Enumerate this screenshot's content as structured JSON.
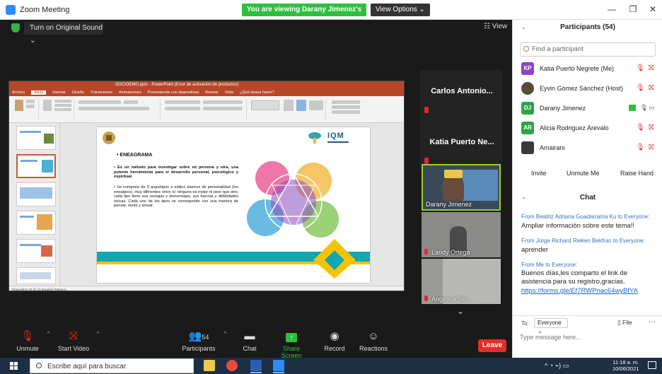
{
  "window": {
    "title": "Zoom Meeting",
    "viewing_banner": "You are viewing Darany Jimenez's screen",
    "view_options": "View Options ⌄",
    "minimize": "—",
    "maximize": "❐",
    "close": "✕"
  },
  "top_controls": {
    "original_sound": "Turn on Original Sound  ⌄",
    "view": "☷ View"
  },
  "shared_screen": {
    "ppt_title": "SOCIOEMO.pptx - PowerPoint (Error de activación de productos)",
    "ppt_tabs": [
      "Archivo",
      "Inicio",
      "Insertar",
      "Diseño",
      "Transiciones",
      "Animaciones",
      "Presentación con diapositivas",
      "Revisar",
      "Vista",
      "¿Qué desea hacer?"
    ],
    "ppt_status": "Diapositiva 10 de 21    Español (México)",
    "slide": {
      "heading": "• ENEAGRAMA",
      "paragraph1": "• Es un método para investigar sobre mi persona y otra, una potente herramienta para el desarrollo personal, psicológico y espiritual.",
      "paragraph2": "• Se compone de 9 arquetipos o estilos básicos de personalidad (los eneatipos), muy diferentes entre sí; ninguno es mejor ni peor que otro; cada tipo tiene sus ventajas y desventajas, sus fuerzas y debilidades únicas. Cada uno de los tipos se corresponde con una manera de pensar, sentir y actuar.",
      "logo_text": "IQM"
    }
  },
  "tiles": [
    {
      "name": "Carlos Antonio...",
      "kind": "name"
    },
    {
      "name": "Katia Puerto Ne...",
      "kind": "name"
    },
    {
      "name": "Darany Jimenez",
      "kind": "video",
      "active": true
    },
    {
      "name": "Landy Ortega",
      "kind": "video"
    },
    {
      "name": "Angelica Silv...",
      "kind": "video"
    }
  ],
  "controls": {
    "unmute": "Unmute",
    "start_video": "Start Video",
    "participants": "Participants",
    "participants_count": "54",
    "chat": "Chat",
    "share_screen": "Share Screen",
    "record": "Record",
    "reactions": "Reactions",
    "leave": "Leave"
  },
  "participants_panel": {
    "title": "Participants (54)",
    "search_placeholder": "Find a participant",
    "list": [
      {
        "initials": "KP",
        "name": "Katia Puerto Negrete (Me)",
        "color": "#8e44c2"
      },
      {
        "initials": "",
        "name": "Eyvin Gómez Sánchez (Host)",
        "color": "#5a4a3a"
      },
      {
        "initials": "DJ",
        "name": "Darany Jimenez",
        "color": "#2fa34a"
      },
      {
        "initials": "AR",
        "name": "Alicia Rodriguez Arevalo",
        "color": "#2fa34a"
      },
      {
        "initials": "",
        "name": "Amairani",
        "color": "#3a3a3a"
      }
    ],
    "invite": "Invite",
    "unmute_me": "Unmute Me",
    "raise_hand": "Raise Hand"
  },
  "chat_panel": {
    "title": "Chat",
    "messages": [
      {
        "from": "From Beatriz Adriana Guadarrama Ku to Everyone:",
        "text": "Ampliar información sobre este tema!!"
      },
      {
        "from": "From Jorge Richard Rieken Bekfran to Everyone:",
        "text": "aprender"
      },
      {
        "from": "From Me to Everyone:",
        "text": "Buenos días,les comparto el link de asistencia para su registro,gracias.",
        "link": "https://forms.gle/Ef7RWPnac64wyBfYA"
      }
    ],
    "to_label": "To:",
    "to_value": "Everyone ⌄",
    "file": "File",
    "more": "···",
    "input_placeholder": "Type message here..."
  },
  "taskbar": {
    "search_placeholder": "Escribe aquí para buscar",
    "tray": "^  ◔  ⌁)  ▭",
    "time": "11:18 a. m.",
    "date": "10/06/2021"
  }
}
